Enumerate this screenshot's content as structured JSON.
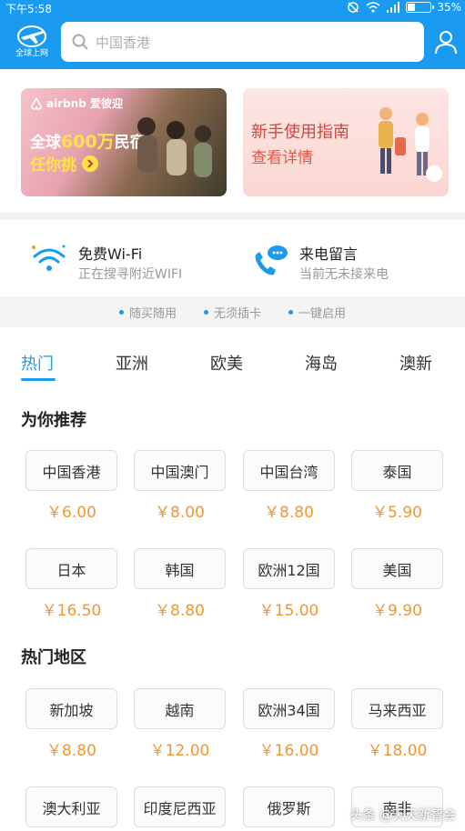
{
  "status_bar": {
    "time": "下午5:58",
    "battery": "35%",
    "battery_level": 0.35
  },
  "header": {
    "logo_caption": "全球上网",
    "search_placeholder": "中国香港"
  },
  "banners": [
    {
      "brand": "airbnb 爱彼迎",
      "line1_prefix": "全球",
      "line1_highlight": "600万",
      "line1_suffix": "民宿",
      "line2": "任你挑"
    },
    {
      "line1": "新手使用指南",
      "line2": "查看详情"
    }
  ],
  "features": [
    {
      "title": "免费Wi-Fi",
      "subtitle": "正在搜寻附近WIFI",
      "icon": "wifi-icon"
    },
    {
      "title": "来电留言",
      "subtitle": "当前无未接来电",
      "icon": "phone-message-icon"
    }
  ],
  "tips": [
    "随买随用",
    "无须插卡",
    "一键启用"
  ],
  "tabs": [
    "热门",
    "亚洲",
    "欧美",
    "海岛",
    "澳新"
  ],
  "active_tab": "热门",
  "sections": [
    {
      "title": "为你推荐",
      "items": [
        {
          "name": "中国香港",
          "price": "￥6.00"
        },
        {
          "name": "中国澳门",
          "price": "￥8.00"
        },
        {
          "name": "中国台湾",
          "price": "￥8.80"
        },
        {
          "name": "泰国",
          "price": "￥5.90"
        },
        {
          "name": "日本",
          "price": "￥16.50"
        },
        {
          "name": "韩国",
          "price": "￥8.80"
        },
        {
          "name": "欧洲12国",
          "price": "￥15.00"
        },
        {
          "name": "美国",
          "price": "￥9.90"
        }
      ]
    },
    {
      "title": "热门地区",
      "items": [
        {
          "name": "新加坡",
          "price": "￥8.80"
        },
        {
          "name": "越南",
          "price": "￥12.00"
        },
        {
          "name": "欧洲34国",
          "price": "￥16.00"
        },
        {
          "name": "马来西亚",
          "price": "￥18.00"
        },
        {
          "name": "澳大利亚",
          "price": ""
        },
        {
          "name": "印度尼西亚",
          "price": ""
        },
        {
          "name": "俄罗斯",
          "price": ""
        },
        {
          "name": "南非",
          "price": ""
        }
      ]
    }
  ],
  "watermark": "头条 @天天新智会",
  "colors": {
    "brand": "#1b9bf0",
    "price": "#f5962c"
  }
}
